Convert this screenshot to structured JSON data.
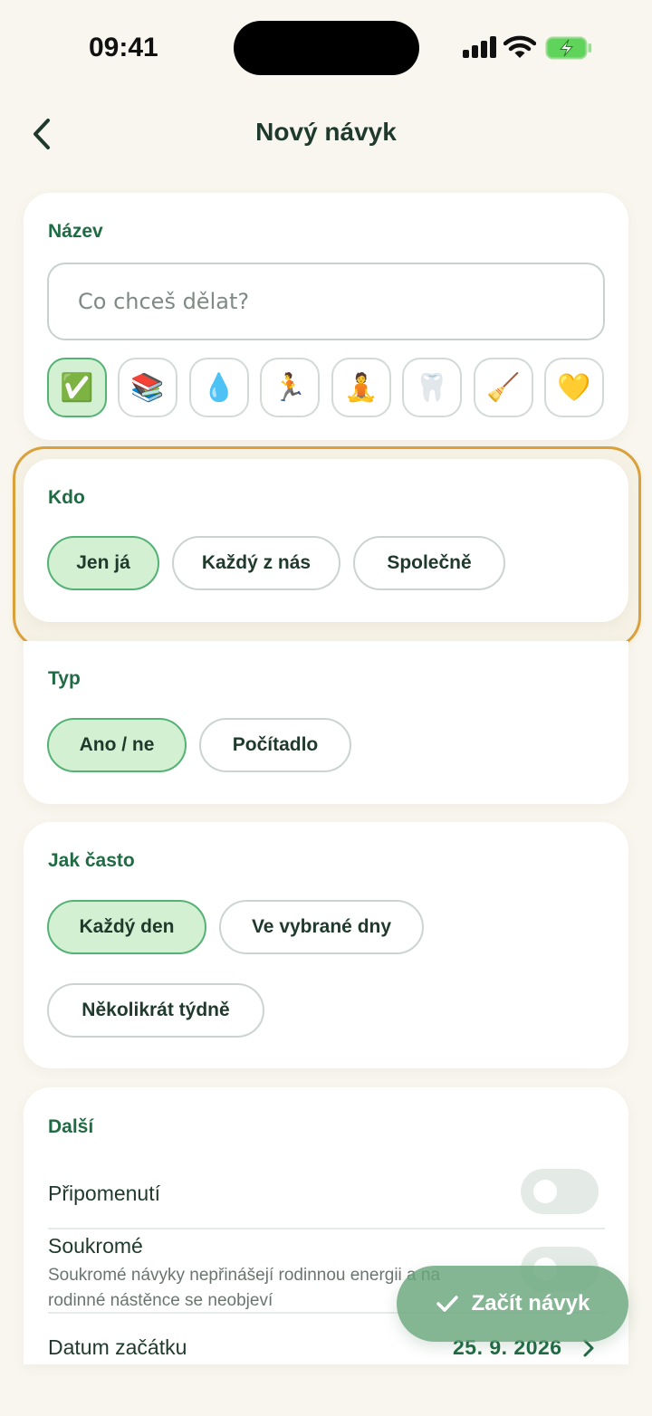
{
  "status_bar": {
    "time": "09:41"
  },
  "header": {
    "title": "Nový návyk"
  },
  "name_card": {
    "label": "Název",
    "placeholder": "Co chceš dělat?",
    "value": "",
    "emojis": [
      "✅",
      "📚",
      "💧",
      "🏃",
      "🧘",
      "🦷",
      "🧹",
      "💛"
    ],
    "selected_emoji": "✅"
  },
  "who_card": {
    "label": "Kdo",
    "options": [
      "Jen já",
      "Každý z nás",
      "Společně"
    ],
    "selected": "Jen já"
  },
  "type_card": {
    "label": "Typ",
    "options": [
      "Ano / ne",
      "Počítadlo"
    ],
    "selected": "Ano / ne"
  },
  "frequency_card": {
    "label": "Jak často",
    "options": [
      "Každý den",
      "Ve vybrané dny",
      "Několikrát týdně"
    ],
    "selected": "Každý den"
  },
  "more_card": {
    "label": "Další",
    "reminder_label": "Připomenutí",
    "reminder_on": false,
    "private_label": "Soukromé",
    "private_desc_line1": "Soukromé návyky nepřinášejí rodinnou energii a na",
    "private_desc_line2": "rodinné nástěnce se neobjeví",
    "private_on": false,
    "start_date_label": "Datum začátku",
    "start_date_value": "25. 9. 2026"
  },
  "cta": {
    "label": "Začít návyk"
  },
  "colors": {
    "background": "#f8f6ee",
    "accent_green": "#1f6b43",
    "chip_selected_bg": "#d3f0d2",
    "highlight_ring": "#d9a03c",
    "cta_bg": "#6aa67c"
  }
}
